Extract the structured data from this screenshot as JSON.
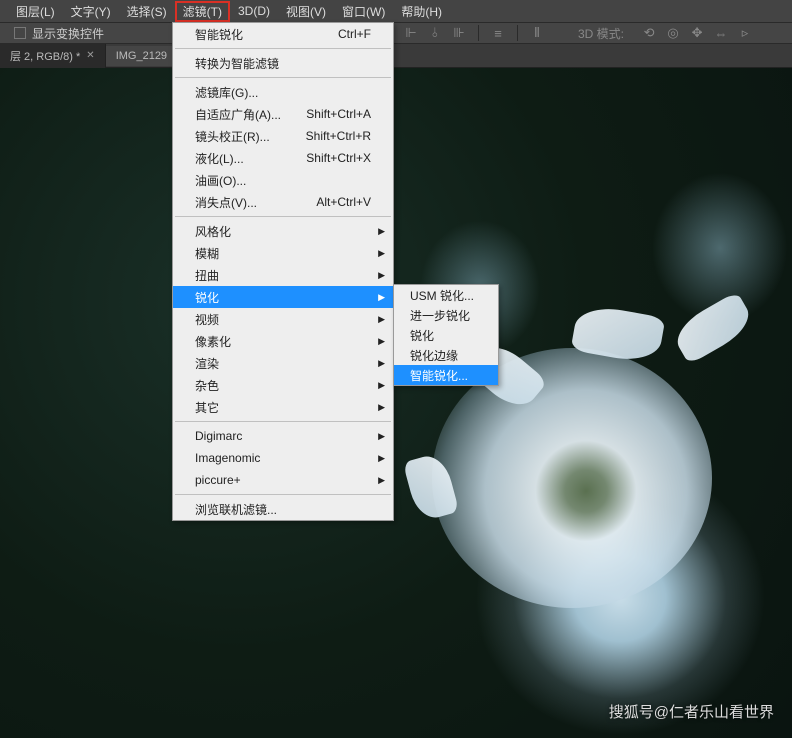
{
  "menubar": {
    "items": [
      "图层(L)",
      "文字(Y)",
      "选择(S)",
      "滤镜(T)",
      "3D(D)",
      "视图(V)",
      "窗口(W)",
      "帮助(H)"
    ],
    "active_index": 3
  },
  "toolbar": {
    "checkbox_label": "显示变换控件",
    "mode3d_label": "3D 模式:"
  },
  "tabs": {
    "items": [
      {
        "label": "层 2, RGB/8) *"
      },
      {
        "label": "IMG_2129"
      }
    ]
  },
  "dropdown": {
    "sections": [
      [
        {
          "label": "智能锐化",
          "shortcut": "Ctrl+F"
        }
      ],
      [
        {
          "label": "转换为智能滤镜"
        }
      ],
      [
        {
          "label": "滤镜库(G)..."
        },
        {
          "label": "自适应广角(A)...",
          "shortcut": "Shift+Ctrl+A"
        },
        {
          "label": "镜头校正(R)...",
          "shortcut": "Shift+Ctrl+R"
        },
        {
          "label": "液化(L)...",
          "shortcut": "Shift+Ctrl+X"
        },
        {
          "label": "油画(O)..."
        },
        {
          "label": "消失点(V)...",
          "shortcut": "Alt+Ctrl+V"
        }
      ],
      [
        {
          "label": "风格化",
          "submenu": true
        },
        {
          "label": "模糊",
          "submenu": true
        },
        {
          "label": "扭曲",
          "submenu": true
        },
        {
          "label": "锐化",
          "submenu": true,
          "highlighted": true
        },
        {
          "label": "视频",
          "submenu": true
        },
        {
          "label": "像素化",
          "submenu": true
        },
        {
          "label": "渲染",
          "submenu": true
        },
        {
          "label": "杂色",
          "submenu": true
        },
        {
          "label": "其它",
          "submenu": true
        }
      ],
      [
        {
          "label": "Digimarc",
          "submenu": true
        },
        {
          "label": "Imagenomic",
          "submenu": true
        },
        {
          "label": "piccure+",
          "submenu": true
        }
      ],
      [
        {
          "label": "浏览联机滤镜..."
        }
      ]
    ]
  },
  "submenu": {
    "items": [
      {
        "label": "USM 锐化..."
      },
      {
        "label": "进一步锐化"
      },
      {
        "label": "锐化"
      },
      {
        "label": "锐化边缘"
      },
      {
        "label": "智能锐化...",
        "highlighted": true
      }
    ]
  },
  "watermark": "搜狐号@仁者乐山看世界"
}
